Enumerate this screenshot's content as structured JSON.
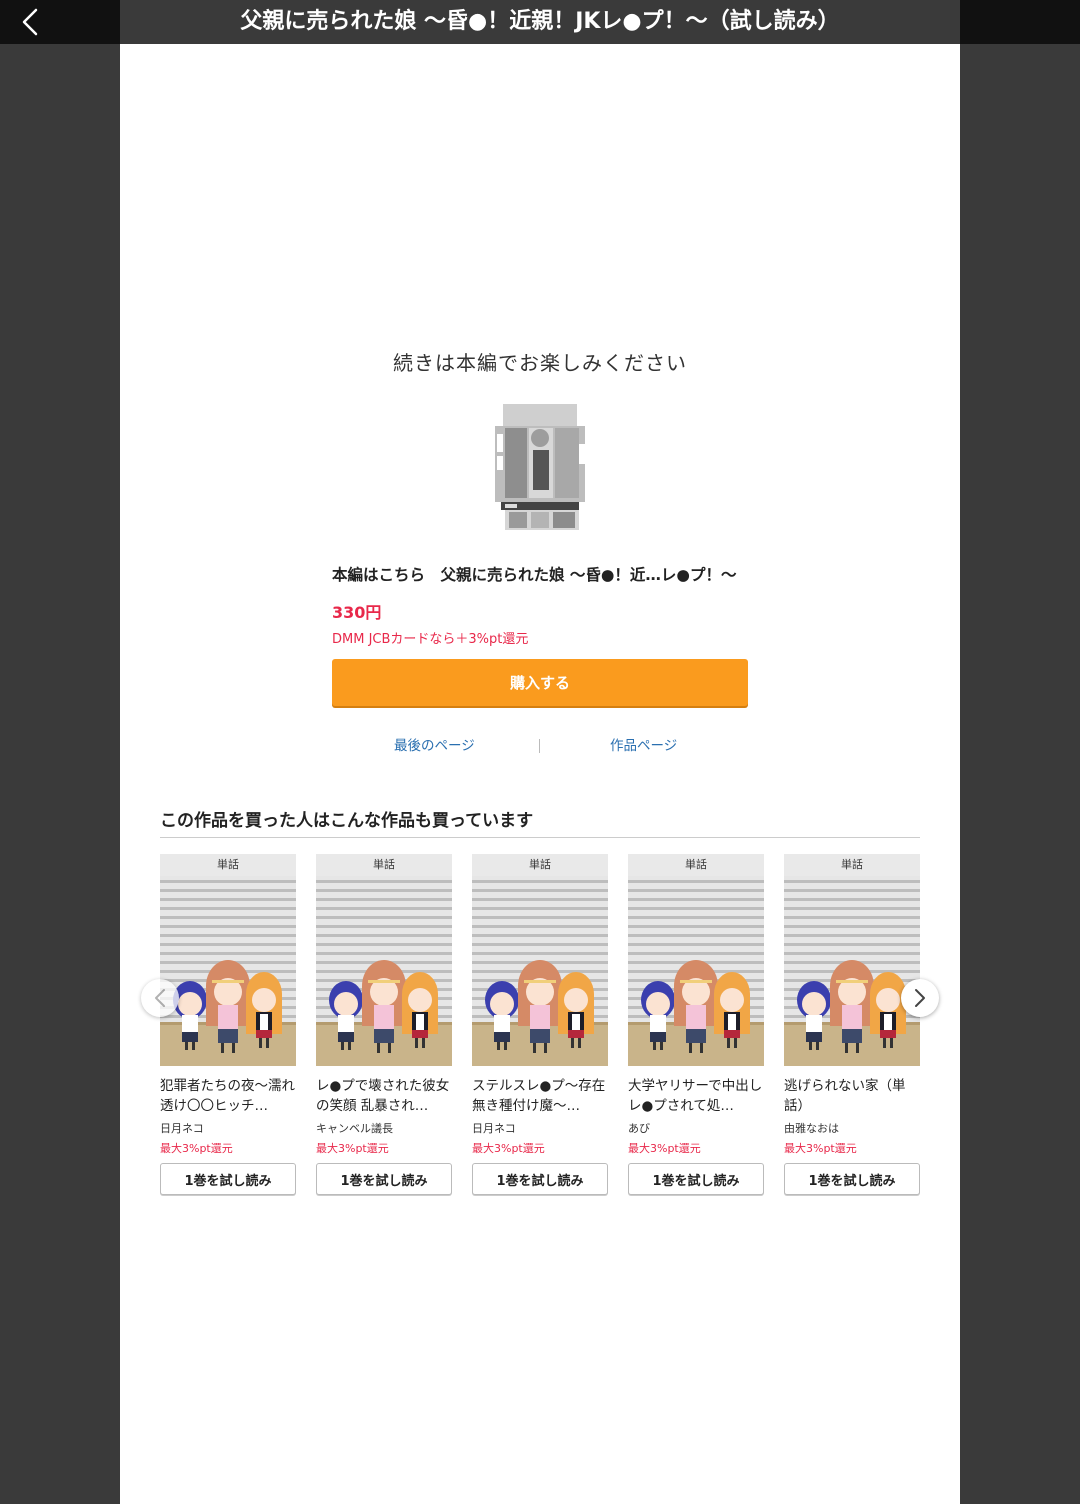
{
  "header": {
    "title": "父親に売られた娘 〜昏●！近親！JKレ●プ！〜（試し読み）",
    "back_icon": "chevron-left-icon"
  },
  "main": {
    "continue_message": "続きは本編でお楽しみください",
    "product_title": "本編はこちら　父親に売られた娘 〜昏●！近…レ●プ！〜",
    "price": "330円",
    "campaign": "DMM JCBカードなら＋3%pt還元",
    "buy_label": "購入する",
    "last_page_link": "最後のページ",
    "work_page_link": "作品ページ"
  },
  "recommendations": {
    "heading": "この作品を買った人はこんな作品も買っています",
    "prev_icon": "chevron-left-icon",
    "next_icon": "chevron-right-icon",
    "items": [
      {
        "type": "単話",
        "title": "犯罪者たちの夜〜濡れ透け〇〇ヒッチ…",
        "author": "日月ネコ",
        "return": "最大3%pt還元",
        "button": "1巻を試し読み"
      },
      {
        "type": "単話",
        "title": "レ●プで壊された彼女の笑顔 乱暴され…",
        "author": "キャンベル議長",
        "return": "最大3%pt還元",
        "button": "1巻を試し読み"
      },
      {
        "type": "単話",
        "title": "ステルスレ●プ〜存在無き種付け魔〜…",
        "author": "日月ネコ",
        "return": "最大3%pt還元",
        "button": "1巻を試し読み"
      },
      {
        "type": "単話",
        "title": "大学ヤリサーで中出しレ●プされて処…",
        "author": "あび",
        "return": "最大3%pt還元",
        "button": "1巻を試し読み"
      },
      {
        "type": "単話",
        "title": "逃げられない家（単話）",
        "author": "由雅なおは",
        "return": "最大3%pt還元",
        "button": "1巻を試し読み"
      }
    ]
  },
  "colors": {
    "accent_orange": "#fa9b1e",
    "price_red": "#e8284a",
    "link_blue": "#2a6fb0"
  }
}
